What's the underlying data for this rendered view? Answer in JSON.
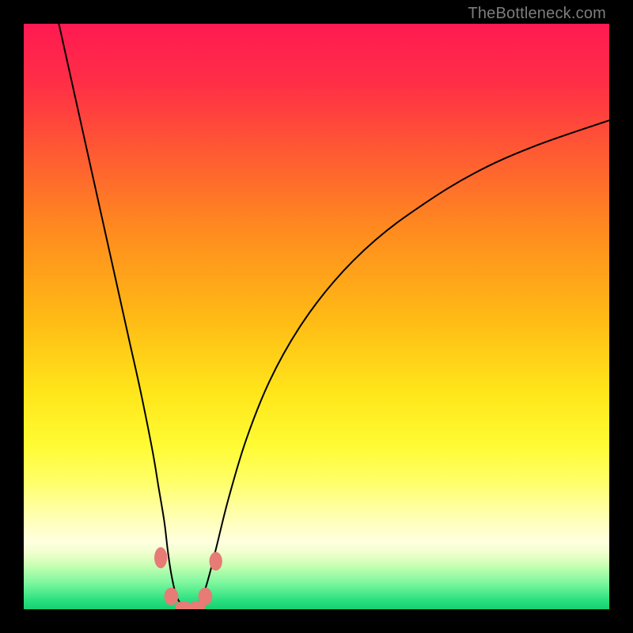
{
  "watermark": "TheBottleneck.com",
  "gradient": {
    "stops": [
      {
        "offset": 0.0,
        "color": "#ff1a52"
      },
      {
        "offset": 0.1,
        "color": "#ff2e46"
      },
      {
        "offset": 0.22,
        "color": "#ff5a33"
      },
      {
        "offset": 0.35,
        "color": "#ff8a1f"
      },
      {
        "offset": 0.5,
        "color": "#ffb915"
      },
      {
        "offset": 0.63,
        "color": "#ffe61a"
      },
      {
        "offset": 0.72,
        "color": "#fffb33"
      },
      {
        "offset": 0.78,
        "color": "#ffff66"
      },
      {
        "offset": 0.84,
        "color": "#ffffb0"
      },
      {
        "offset": 0.885,
        "color": "#ffffe0"
      },
      {
        "offset": 0.905,
        "color": "#eeffcc"
      },
      {
        "offset": 0.925,
        "color": "#c8ffb3"
      },
      {
        "offset": 0.955,
        "color": "#7cf79e"
      },
      {
        "offset": 0.985,
        "color": "#29e07f"
      },
      {
        "offset": 1.0,
        "color": "#17cf72"
      }
    ]
  },
  "chart_data": {
    "type": "line",
    "title": "",
    "xlabel": "",
    "ylabel": "",
    "xlim": [
      0,
      100
    ],
    "ylim": [
      0,
      100
    ],
    "series": [
      {
        "name": "curve-left",
        "x": [
          6,
          8,
          10,
          12,
          14,
          16,
          18,
          20,
          22,
          23,
          24,
          24.6,
          25.2,
          26,
          27,
          28.5
        ],
        "y": [
          100,
          91,
          82,
          73,
          64,
          55,
          46,
          37,
          27,
          21,
          15,
          10,
          6,
          2.5,
          0.8,
          0
        ]
      },
      {
        "name": "curve-right",
        "x": [
          28.5,
          30,
          31,
          32,
          33,
          35,
          38,
          42,
          47,
          53,
          60,
          68,
          77,
          87,
          100
        ],
        "y": [
          0,
          1.2,
          3.5,
          7,
          11,
          19,
          29,
          39,
          48,
          56,
          63,
          69,
          74.5,
          79,
          83.5
        ]
      }
    ],
    "markers": {
      "name": "bottom-dots",
      "color": "#e77b76",
      "points": [
        {
          "x": 23.4,
          "y": 8.8,
          "rx": 1.1,
          "ry": 1.8
        },
        {
          "x": 25.2,
          "y": 2.2,
          "rx": 1.2,
          "ry": 1.5
        },
        {
          "x": 27.3,
          "y": 0.4,
          "rx": 1.4,
          "ry": 1.0
        },
        {
          "x": 29.6,
          "y": 0.4,
          "rx": 1.4,
          "ry": 1.0
        },
        {
          "x": 31.0,
          "y": 2.2,
          "rx": 1.2,
          "ry": 1.5
        },
        {
          "x": 32.8,
          "y": 8.2,
          "rx": 1.1,
          "ry": 1.6
        }
      ]
    }
  }
}
